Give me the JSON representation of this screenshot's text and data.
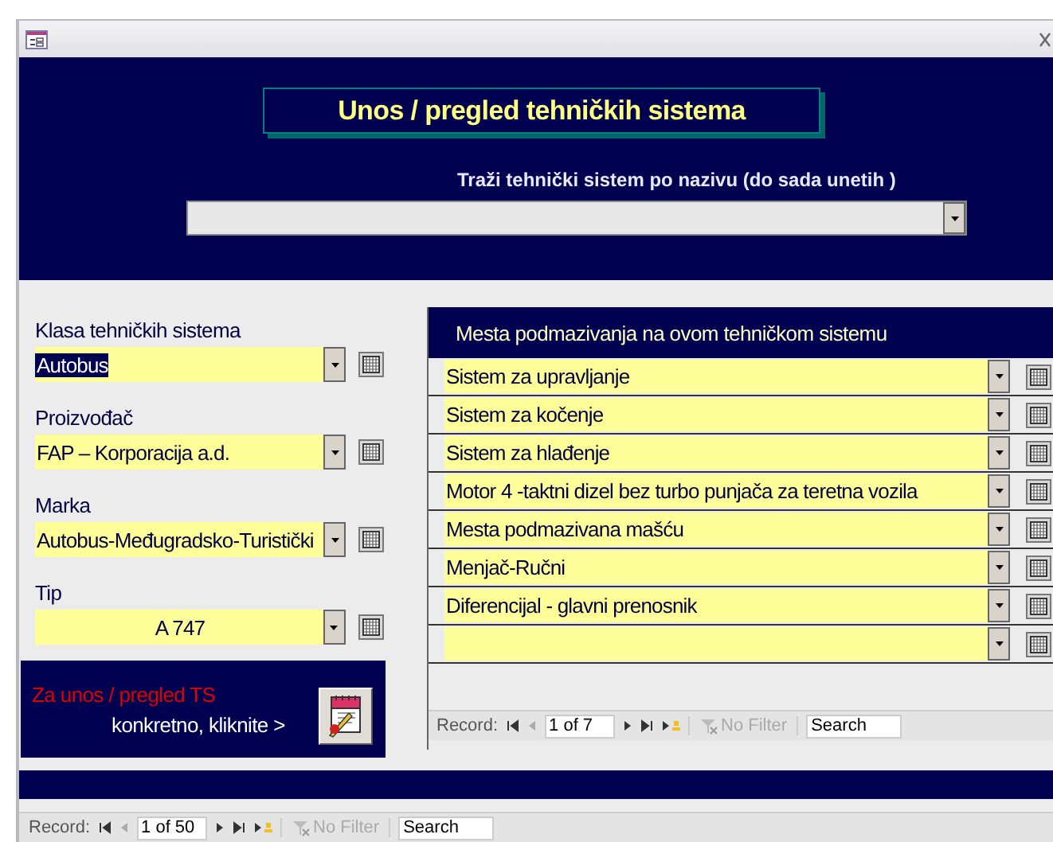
{
  "form": {
    "title": "Unos / pregled tehničkih sistema",
    "search_label": "Traži tehnički sistem po nazivu  (do sada unetih )"
  },
  "fields": [
    {
      "kind": "left",
      "label": "Klasa tehničkih sistema",
      "value": "Autobus",
      "highlighted": true
    },
    {
      "kind": "left",
      "label": "Proizvođač",
      "value": "FAP – Korporacija a.d.",
      "highlighted": false
    },
    {
      "kind": "left",
      "label": "Marka",
      "value": "Autobus-Međugradsko-Turistički",
      "highlighted": false
    },
    {
      "kind": "center",
      "label": "Tip",
      "value": "A 747",
      "highlighted": false
    }
  ],
  "open_panel": {
    "line_1": "Za unos / pregled TS",
    "line_2": "konkretno, kliknite >"
  },
  "subform": {
    "heading": "Mesta podmazivanja na ovom tehničkom sistemu",
    "rows": [
      {
        "kind": "record",
        "value": "Sistem za upravljanje"
      },
      {
        "kind": "record",
        "value": "Sistem za kočenje"
      },
      {
        "kind": "record",
        "value": "Sistem za hlađenje"
      },
      {
        "kind": "record",
        "value": "Motor 4 -taktni dizel bez turbo punjača za teretna vozila"
      },
      {
        "kind": "record",
        "value": "Mesta podmazivana mašću"
      },
      {
        "kind": "record",
        "value": "Menjač-Ručni"
      },
      {
        "kind": "record",
        "value": "Diferencijal - glavni prenosnik"
      },
      {
        "kind": "new"
      }
    ],
    "navigation": {
      "label": "Record:",
      "position": "1 of 7",
      "filter": "No Filter",
      "search_placeholder": "Search"
    }
  },
  "navigation": {
    "label": "Record:",
    "position": "1 of 50",
    "filter": "No Filter",
    "search_placeholder": "Search"
  }
}
